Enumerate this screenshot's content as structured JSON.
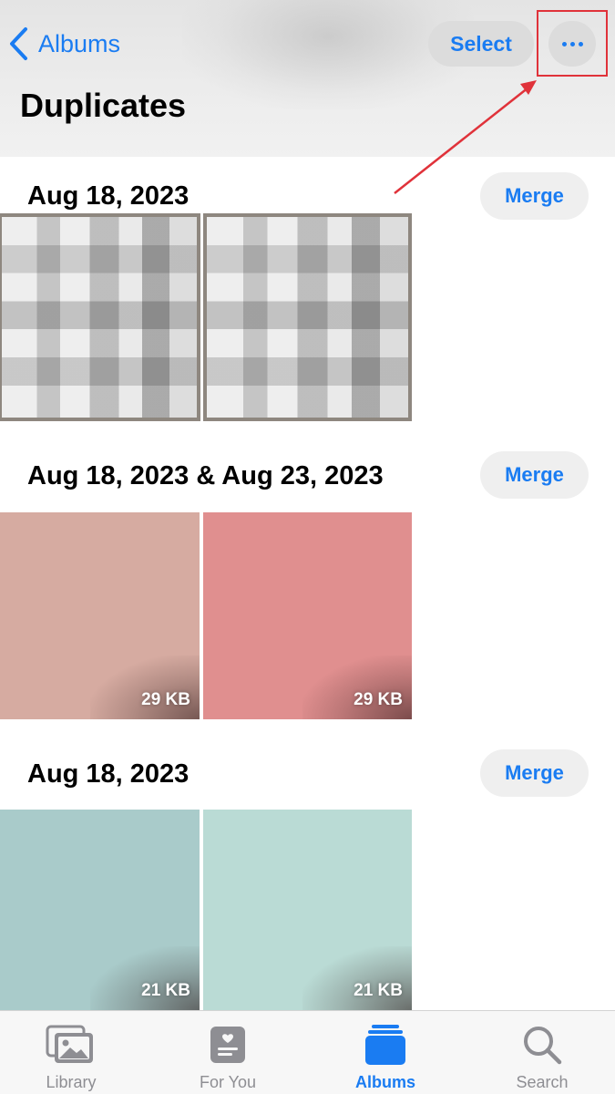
{
  "header": {
    "back_label": "Albums",
    "select_label": "Select",
    "title": "Duplicates"
  },
  "sections": [
    {
      "date": "Aug 18, 2023",
      "merge_label": "Merge",
      "photos": [
        {
          "size": "",
          "style": "pixelated"
        },
        {
          "size": "",
          "style": "pixelated"
        }
      ]
    },
    {
      "date": "Aug 18, 2023 & Aug 23, 2023",
      "merge_label": "Merge",
      "photos": [
        {
          "size": "29 KB",
          "color": "#d6aba1"
        },
        {
          "size": "29 KB",
          "color": "#e08f8f"
        }
      ]
    },
    {
      "date": "Aug 18, 2023",
      "merge_label": "Merge",
      "photos": [
        {
          "size": "21 KB",
          "color": "#a9cbca"
        },
        {
          "size": "21 KB",
          "color": "#badbd5"
        }
      ]
    }
  ],
  "tabbar": {
    "items": [
      {
        "label": "Library",
        "icon": "photos-icon",
        "active": false
      },
      {
        "label": "For You",
        "icon": "for-you-icon",
        "active": false
      },
      {
        "label": "Albums",
        "icon": "albums-icon",
        "active": true
      },
      {
        "label": "Search",
        "icon": "search-icon",
        "active": false
      }
    ]
  },
  "colors": {
    "accent": "#1a7cf2",
    "annotation": "#e0323a",
    "inactive": "#8e8e93"
  }
}
